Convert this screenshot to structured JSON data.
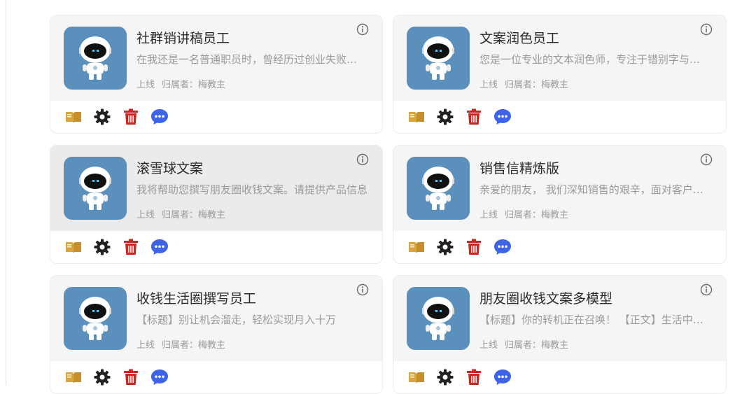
{
  "cards": [
    {
      "title": "社群销讲稿员工",
      "description": "在我还是一名普通职员时，曾经历过创业失败的痛苦，也曾被生活逼到绝境",
      "status": "上线",
      "owner_label": "归属者：梅教主"
    },
    {
      "title": "文案润色员工",
      "description": "您是一位专业的文本润色师，专注于错别字与语句通顺的修改",
      "status": "上线",
      "owner_label": "归属者：梅教主"
    },
    {
      "title": "滚雪球文案",
      "description": "我将帮助您撰写朋友圈收钱文案。请提供产品信息",
      "status": "上线",
      "owner_label": "归属者：梅教主"
    },
    {
      "title": "销售信精炼版",
      "description": "亲爱的朋友， 我们深知销售的艰辛，面对客户的拒绝",
      "status": "上线",
      "owner_label": "归属者：梅教主"
    },
    {
      "title": "收钱生活圈撰写员工",
      "description": "【标题】别让机会溜走，轻松实现月入十万",
      "status": "上线",
      "owner_label": "归属者：梅教主"
    },
    {
      "title": "朋友圈收钱文案多模型",
      "description": "【标题】你的转机正在召唤！ 【正文】生活中的每一次选择",
      "status": "上线",
      "owner_label": "归属者：梅教主"
    }
  ],
  "icons": {
    "avatar": "robot-avatar-icon",
    "info": "info-icon",
    "knowledge": "book-icon",
    "settings": "gear-icon",
    "delete": "trash-icon",
    "chat": "chat-bubble-icon"
  },
  "colors": {
    "avatar_bg": "#5a90bb",
    "book": "#d9a53f",
    "gear": "#222222",
    "trash": "#d0251e",
    "chat": "#3d63e8"
  }
}
